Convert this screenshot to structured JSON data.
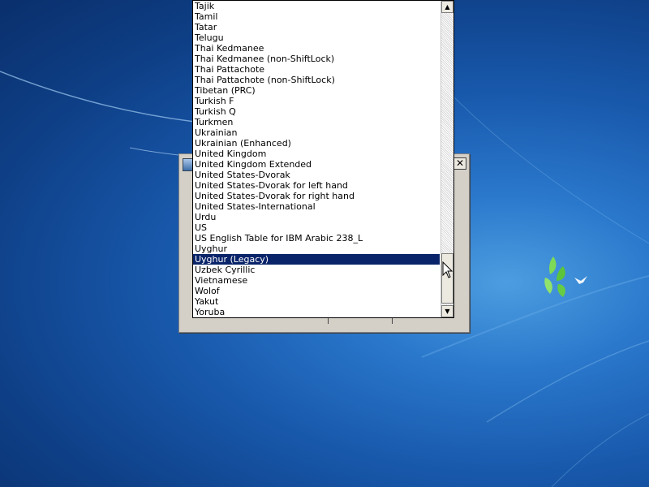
{
  "listbox": {
    "items": [
      "Tajik",
      "Tamil",
      "Tatar",
      "Telugu",
      "Thai Kedmanee",
      "Thai Kedmanee (non-ShiftLock)",
      "Thai Pattachote",
      "Thai Pattachote (non-ShiftLock)",
      "Tibetan (PRC)",
      "Turkish F",
      "Turkish Q",
      "Turkmen",
      "Ukrainian",
      "Ukrainian (Enhanced)",
      "United Kingdom",
      "United Kingdom Extended",
      "United States-Dvorak",
      "United States-Dvorak for left hand",
      "United States-Dvorak for right hand",
      "United States-International",
      "Urdu",
      "US",
      "US English Table for IBM Arabic 238_L",
      "Uyghur",
      "Uyghur (Legacy)",
      "Uzbek Cyrillic",
      "Vietnamese",
      "Wolof",
      "Yakut",
      "Yoruba"
    ],
    "selected_index": 24
  },
  "dialog": {
    "close_glyph": "✕"
  },
  "scrollbar": {
    "up_glyph": "▲",
    "down_glyph": "▼"
  },
  "colors": {
    "selection": "#0a246a",
    "desktop": "#1858ab"
  }
}
